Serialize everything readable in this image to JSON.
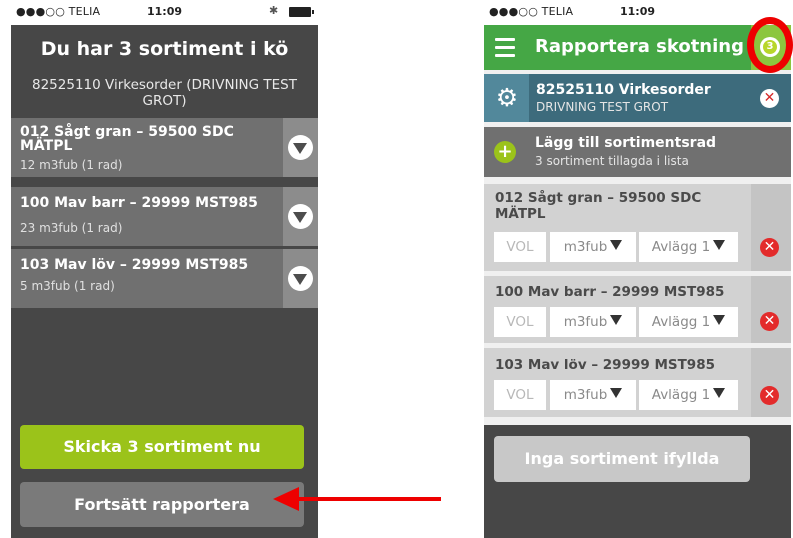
{
  "status": {
    "carrier": "●●●○○ TELIA",
    "time": "11:09"
  },
  "left": {
    "title": "Du har 3 sortiment i kö",
    "order": "82525110 Virkesorder (DRIVNING TEST GROT)",
    "items": [
      {
        "name": "012 Sågt gran – 59500 SDC MÄTPL",
        "qty": "12 m3fub (1 rad)"
      },
      {
        "name": "100 Mav barr – 29999 MST985",
        "qty": "23 m3fub (1 rad)"
      },
      {
        "name": "103 Mav löv – 29999 MST985",
        "qty": "5 m3fub (1 rad)"
      }
    ],
    "send_button": "Skicka 3 sortiment nu",
    "continue_button": "Fortsätt rapportera"
  },
  "right": {
    "header_title": "Rapportera skotning",
    "badge_count": "3",
    "order_line1": "82525110 Virkesorder",
    "order_line2": "DRIVNING TEST GROT",
    "add_line1": "Lägg till sortimentsrad",
    "add_line2": "3 sortiment tillagda i lista",
    "items": [
      {
        "name": "012 Sågt gran – 59500 SDC MÄTPL",
        "vol": "VOL",
        "unit": "m3fub",
        "avlagg": "Avlägg 1"
      },
      {
        "name": "100 Mav barr – 29999 MST985",
        "vol": "VOL",
        "unit": "m3fub",
        "avlagg": "Avlägg 1"
      },
      {
        "name": "103 Mav löv – 29999 MST985",
        "vol": "VOL",
        "unit": "m3fub",
        "avlagg": "Avlägg 1"
      }
    ],
    "none_button": "Inga sortiment ifyllda"
  },
  "colors": {
    "accent_green": "#45a745",
    "lime": "#9bc31a",
    "teal": "#3d6b7c",
    "annotation_red": "#ee0000"
  }
}
